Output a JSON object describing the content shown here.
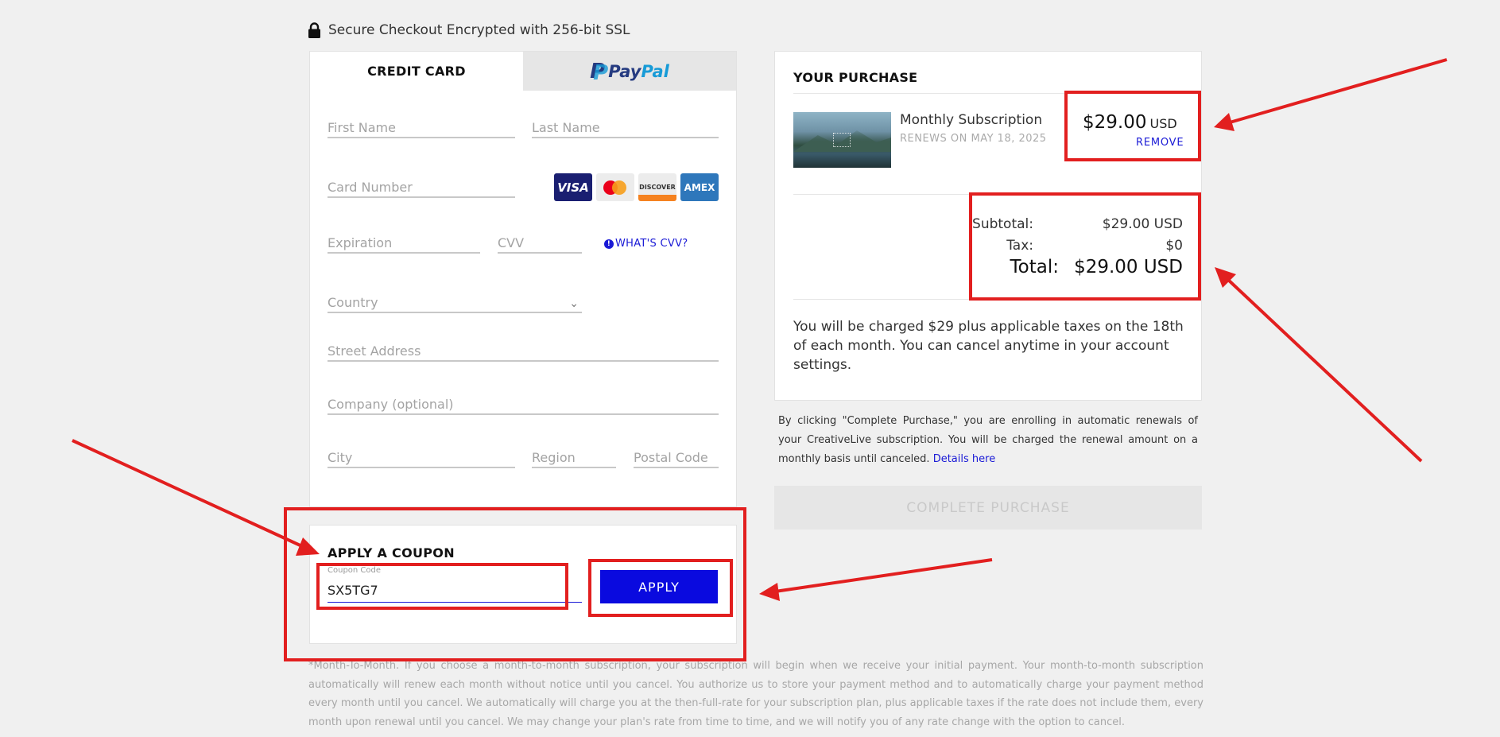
{
  "secure": {
    "icon": "lock-icon",
    "text": "Secure Checkout Encrypted with 256-bit SSL"
  },
  "tabs": {
    "credit_card": "CREDIT CARD",
    "paypal_part1": "Pay",
    "paypal_part2": "Pal"
  },
  "form": {
    "first_name": "First Name",
    "last_name": "Last Name",
    "card_number": "Card Number",
    "card_logos": [
      "VISA",
      "mastercard",
      "DISCOVER",
      "AMEX"
    ],
    "expiration": "Expiration",
    "cvv": "CVV",
    "whats_cvv": "WHAT'S CVV?",
    "country": "Country",
    "street": "Street Address",
    "company": "Company (optional)",
    "city": "City",
    "region": "Region",
    "postal": "Postal Code"
  },
  "coupon": {
    "title": "APPLY A COUPON",
    "field_label": "Coupon Code",
    "value": "SX5TG7",
    "apply": "APPLY"
  },
  "purchase": {
    "title": "YOUR PURCHASE",
    "item_name": "Monthly Subscription",
    "renews": "RENEWS ON MAY 18, 2025",
    "price": "$29.00",
    "currency": "USD",
    "remove": "REMOVE",
    "subtotal_label": "Subtotal:",
    "subtotal_value": "$29.00 USD",
    "tax_label": "Tax:",
    "tax_value": "$0",
    "total_label": "Total:",
    "total_value": "$29.00 USD",
    "note": "You will be charged $29 plus applicable taxes on the 18th of each month. You can cancel anytime in your account settings."
  },
  "fine_print": {
    "text": "By clicking \"Complete Purchase,\" you are enrolling in automatic renewals of your CreativeLive subscription. You will be charged the renewal amount on a monthly basis until canceled. ",
    "link": "Details here"
  },
  "complete_button": "COMPLETE PURCHASE",
  "legal": "*Month-To-Month. If you choose a month-to-month subscription, your subscription will begin when we receive your initial payment. Your month-to-month subscription automatically will renew each month without notice until you cancel. You authorize us to store your payment method and to automatically charge your payment method every month until you cancel. We automatically will charge you at the then-full-rate for your subscription plan, plus applicable taxes if the rate does not include them, every month upon renewal until you cancel. We may change your plan's rate from time to time, and we will notify you of any rate change with the option to cancel.",
  "colors": {
    "accent_blue": "#0a0adf",
    "annotation_red": "#e21f1f"
  }
}
